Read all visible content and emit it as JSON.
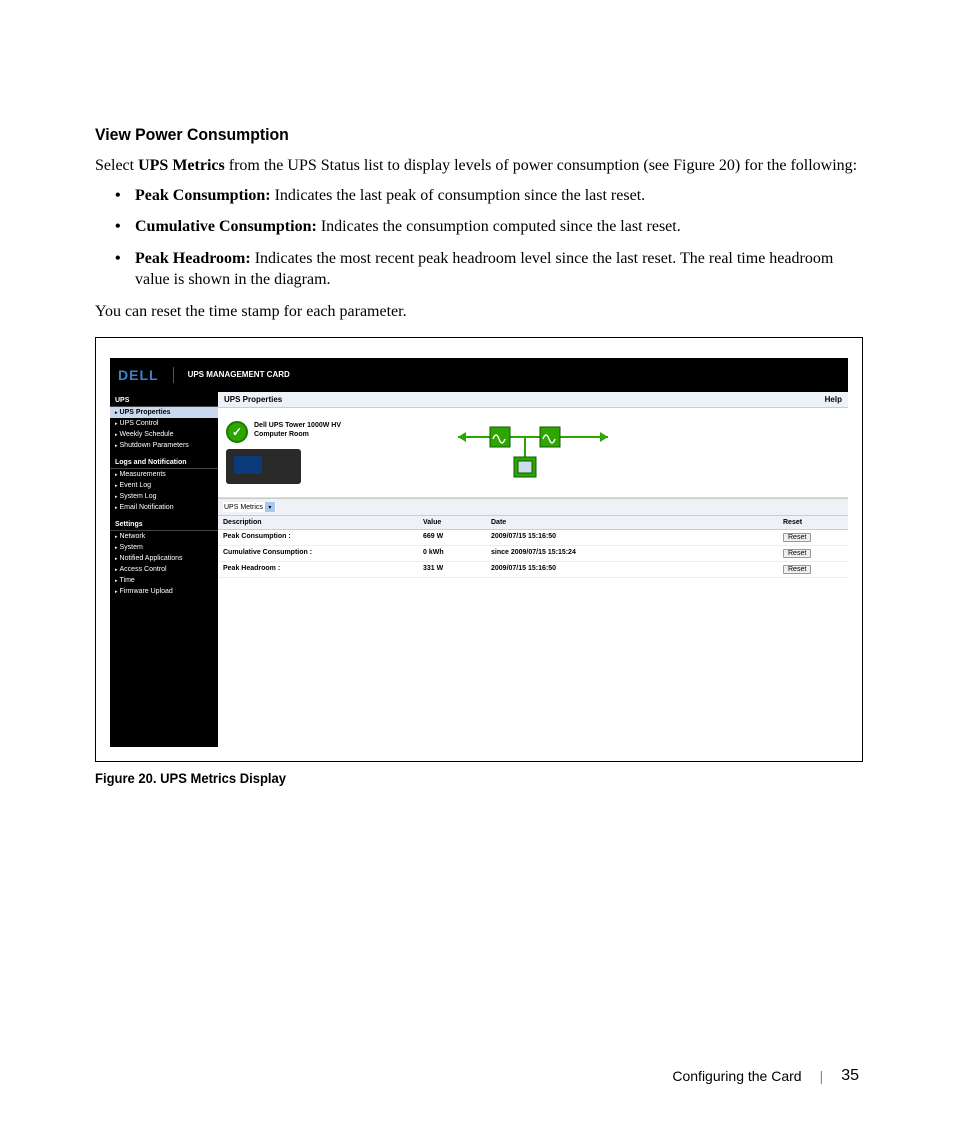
{
  "heading": "View Power Consumption",
  "intro_pre": "Select ",
  "intro_bold": "UPS Metrics",
  "intro_post": " from the UPS Status list to display levels of power consumption (see Figure 20) for the following:",
  "bullets": [
    {
      "label": "Peak Consumption: ",
      "text": "Indicates the last peak of consumption since the last reset."
    },
    {
      "label": "Cumulative Consumption: ",
      "text": "Indicates the consumption computed since the last reset."
    },
    {
      "label": "Peak Headroom: ",
      "text": "Indicates the most recent peak headroom level since the last reset. The real time headroom value is shown in the diagram."
    }
  ],
  "after_text": "You can reset the time stamp for each parameter.",
  "figure_caption": "Figure 20. UPS Metrics Display",
  "ui": {
    "header": {
      "logo": "DELL",
      "title": "UPS MANAGEMENT CARD"
    },
    "sidebar": {
      "group1": "UPS",
      "g1items": [
        "UPS Properties",
        "UPS Control",
        "Weekly Schedule",
        "Shutdown Parameters"
      ],
      "group2": "Logs and Notification",
      "g2items": [
        "Measurements",
        "Event Log",
        "System Log",
        "Email Notification"
      ],
      "group3": "Settings",
      "g3items": [
        "Network",
        "System",
        "Notified Applications",
        "Access Control",
        "Time",
        "Firmware Upload"
      ]
    },
    "panel": {
      "title": "UPS Properties",
      "help": "Help",
      "device_line1": "Dell UPS Tower 1000W HV",
      "device_line2": "Computer Room",
      "dropdown": "UPS Metrics",
      "columns": {
        "desc": "Description",
        "val": "Value",
        "date": "Date",
        "reset": "Reset"
      },
      "rows": [
        {
          "desc": "Peak Consumption :",
          "val": "669 W",
          "date": "2009/07/15 15:16:50",
          "reset": "Reset"
        },
        {
          "desc": "Cumulative Consumption :",
          "val": "0 kWh",
          "date": "since 2009/07/15 15:15:24",
          "reset": "Reset"
        },
        {
          "desc": "Peak Headroom :",
          "val": "331 W",
          "date": "2009/07/15 15:16:50",
          "reset": "Reset"
        }
      ]
    }
  },
  "footer": {
    "section": "Configuring the Card",
    "page": "35"
  }
}
